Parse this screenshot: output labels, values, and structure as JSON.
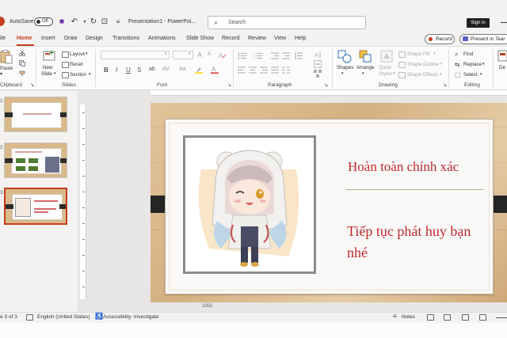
{
  "titlebar": {
    "autosave_label": "AutoSave",
    "autosave_state": "Off",
    "doc_title": "Presentation1 - PowerPoi...",
    "search_placeholder": "Search",
    "signin_label": "Sign in"
  },
  "tabs": [
    "ile",
    "Home",
    "Insert",
    "Draw",
    "Design",
    "Transitions",
    "Animations",
    "Slide Show",
    "Record",
    "Review",
    "View",
    "Help"
  ],
  "active_tab": "Home",
  "record_button": "Record",
  "present_button": "Present in Tear",
  "ribbon": {
    "clipboard": {
      "paste": "Paste",
      "group": "Clipboard"
    },
    "slides": {
      "new_slide": "New",
      "new_slide_2": "Slide",
      "layout": "Layout",
      "reset": "Reset",
      "section": "Section",
      "group": "Slides"
    },
    "font": {
      "group": "Font",
      "bold": "B",
      "italic": "I",
      "underline": "U",
      "strike": "S",
      "grow": "A",
      "shrink": "A"
    },
    "paragraph": {
      "group": "Paragraph"
    },
    "drawing": {
      "shapes": "Shapes",
      "arrange": "Arrange",
      "quick_styles": "Quick",
      "quick_styles_2": "Styles",
      "shape_fill": "Shape Fill",
      "shape_outline": "Shape Outline",
      "shape_effects": "Shape Effects",
      "group": "Drawing"
    },
    "editing": {
      "find": "Find",
      "replace": "Replace",
      "select": "Select",
      "group": "Editing"
    },
    "designer": {
      "label": "De"
    }
  },
  "thumbnails": [
    {
      "num": "1"
    },
    {
      "num": "2"
    },
    {
      "num": "3",
      "selected": true
    }
  ],
  "slide": {
    "heading1": "Hoàn toàn chính xác",
    "heading2": "Tiếp tục phát huy bạn nhé",
    "canvas_label": "1001"
  },
  "status": {
    "slide_counter": "e 3 of 3",
    "language": "English (United States)",
    "accessibility": "Accessibility: Investigate",
    "notes": "Notes"
  },
  "colors": {
    "accent": "#c43e1c",
    "slide_text": "#c0282d"
  }
}
